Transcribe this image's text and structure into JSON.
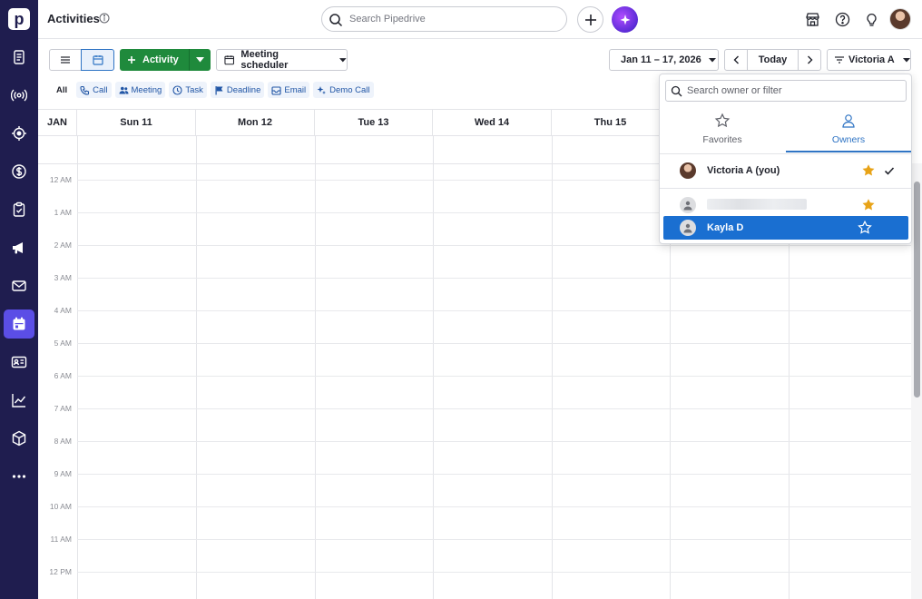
{
  "app": {
    "page_title": "Activities",
    "search_placeholder": "Search Pipedrive",
    "logo_letter": "p",
    "nav_icons": [
      "leads-icon",
      "radar-icon",
      "target-icon",
      "dollar-icon",
      "clipboard-icon",
      "megaphone-icon",
      "mail-icon",
      "calendar-icon",
      "contact-card-icon",
      "chart-icon",
      "box-icon",
      "more-icon"
    ],
    "active_nav": "calendar-icon"
  },
  "toolbar": {
    "activity_label": "Activity",
    "meeting_scheduler_label": "Meeting scheduler",
    "date_range": "Jan 11 – 17, 2026",
    "today_label": "Today",
    "owner_filter_label": "Victoria A"
  },
  "filters": [
    {
      "label": "All",
      "icon": ""
    },
    {
      "label": "Call",
      "icon": "phone-icon"
    },
    {
      "label": "Meeting",
      "icon": "people-icon"
    },
    {
      "label": "Task",
      "icon": "clock-icon"
    },
    {
      "label": "Deadline",
      "icon": "flag-icon"
    },
    {
      "label": "Email",
      "icon": "email-icon"
    },
    {
      "label": "Demo Call",
      "icon": "sparkle-icon"
    }
  ],
  "calendar": {
    "month": "JAN",
    "days": [
      "Sun 11",
      "Mon 12",
      "Tue 13",
      "Wed 14",
      "Thu 15"
    ],
    "hours": [
      "12 AM",
      "1 AM",
      "2 AM",
      "3 AM",
      "4 AM",
      "5 AM",
      "6 AM",
      "7 AM",
      "8 AM",
      "9 AM",
      "10 AM",
      "11 AM",
      "12 PM"
    ]
  },
  "owner_popup": {
    "search_placeholder": "Search owner or filter",
    "tabs": [
      {
        "label": "Favorites",
        "icon": "star-outline-icon"
      },
      {
        "label": "Owners",
        "icon": "person-icon"
      }
    ],
    "active_tab": "Owners",
    "rows": [
      {
        "name": "Victoria A (you)",
        "favorite": true,
        "checked": true
      },
      {
        "name": "",
        "favorite": true,
        "checked": false
      },
      {
        "name": "Kayla D",
        "favorite": false,
        "checked": false,
        "highlighted": true
      }
    ]
  },
  "colors": {
    "rail": "#1f1d4f",
    "accent_green": "#1f8a3c",
    "accent_blue": "#2f74c4",
    "star": "#e8a317"
  }
}
